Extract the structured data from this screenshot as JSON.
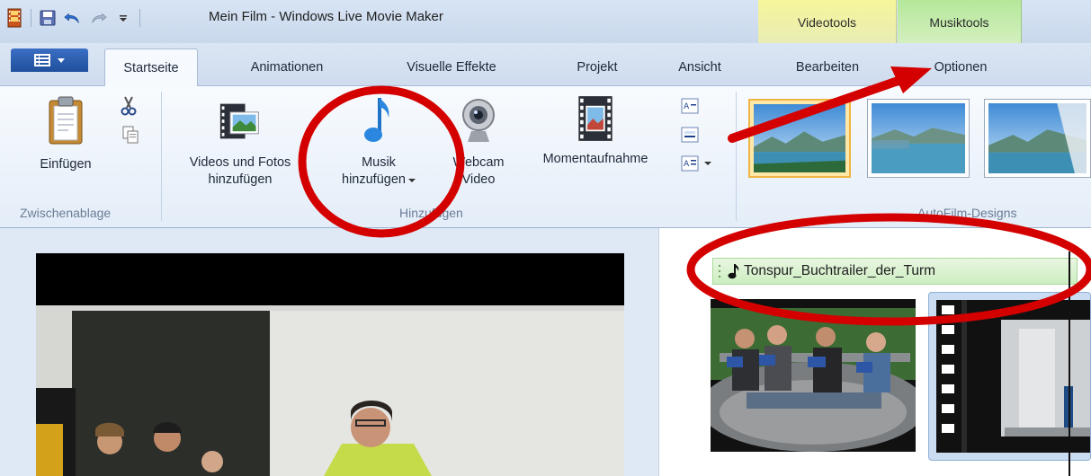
{
  "window": {
    "title": "Mein Film - Windows Live Movie Maker"
  },
  "context_tabs": {
    "video": "Videotools",
    "music": "Musiktools"
  },
  "tabs": [
    {
      "label": "Startseite",
      "active": true
    },
    {
      "label": "Animationen",
      "active": false
    },
    {
      "label": "Visuelle Effekte",
      "active": false
    },
    {
      "label": "Projekt",
      "active": false
    },
    {
      "label": "Ansicht",
      "active": false
    },
    {
      "label": "Bearbeiten",
      "active": false
    },
    {
      "label": "Optionen",
      "active": false
    }
  ],
  "ribbon": {
    "clipboard": {
      "paste_label": "Einfügen",
      "group_label": "Zwischenablage"
    },
    "add": {
      "videos_line1": "Videos und Fotos",
      "videos_line2": "hinzufügen",
      "music_line1": "Musik",
      "music_line2": "hinzufügen",
      "webcam_line1": "Webcam",
      "webcam_line2": "Video",
      "snapshot_label": "Momentaufnahme",
      "group_label": "Hinzufügen"
    },
    "autofilm": {
      "group_label": "AutoFilm-Designs"
    }
  },
  "storyboard": {
    "music_track_label": "Tonspur_Buchtrailer_der_Turm"
  },
  "colors": {
    "annotation_red": "#d40000",
    "context_video_yellow": "#f2f59a",
    "context_music_green": "#b9e99f",
    "selection_orange": "#f0b542"
  }
}
